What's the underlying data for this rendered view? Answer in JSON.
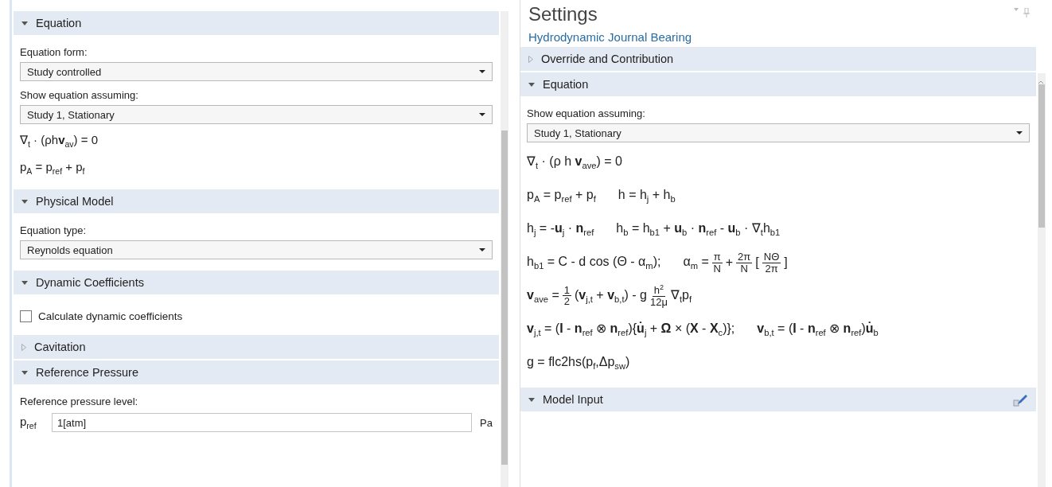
{
  "left_panel": {
    "sections": [
      {
        "title": "Equation",
        "expanded": true,
        "items": [
          {
            "kind": "label",
            "text": "Equation form:"
          },
          {
            "kind": "select",
            "value": "Study controlled"
          },
          {
            "kind": "label",
            "text": "Show equation assuming:"
          },
          {
            "kind": "select",
            "value": "Study 1, Stationary"
          },
          {
            "kind": "equation",
            "groups": [
              {
                "parts": [
                  {
                    "kind": "text",
                    "text": "∇$_{t}$ · (ρh**v**$_{av}$) = 0"
                  }
                ]
              }
            ]
          },
          {
            "kind": "equation",
            "groups": [
              {
                "parts": [
                  {
                    "kind": "text",
                    "text": "p$_{A}$ = p$_{ref}$ + p$_{f}$"
                  }
                ]
              }
            ]
          }
        ]
      },
      {
        "title": "Physical Model",
        "expanded": true,
        "items": [
          {
            "kind": "label",
            "text": "Equation type:"
          },
          {
            "kind": "select",
            "value": "Reynolds equation"
          }
        ]
      },
      {
        "title": "Dynamic Coefficients",
        "expanded": true,
        "items": [
          {
            "kind": "checkbox",
            "text": "Calculate dynamic coefficients",
            "checked": false
          }
        ]
      },
      {
        "title": "Cavitation",
        "expanded": false
      },
      {
        "title": "Reference Pressure",
        "expanded": true,
        "items": [
          {
            "kind": "label",
            "text": "Reference pressure level:"
          },
          {
            "kind": "field",
            "symbol": "p$_{ref}$",
            "value": "1[atm]",
            "unit": "Pa"
          }
        ]
      }
    ]
  },
  "right_panel": {
    "title": "Settings",
    "subtitle": "Hydrodynamic Journal Bearing",
    "sections": [
      {
        "title": "Override and Contribution",
        "expanded": false
      },
      {
        "title": "Equation",
        "expanded": true,
        "items": [
          {
            "kind": "label",
            "text": "Show equation assuming:"
          },
          {
            "kind": "select",
            "value": "Study 1, Stationary"
          },
          {
            "kind": "equation",
            "groups": [
              {
                "parts": [
                  {
                    "kind": "text",
                    "text": "∇$_{t}$ · (ρ h **v**$_{ave}$) = 0"
                  }
                ]
              }
            ]
          },
          {
            "kind": "equation",
            "groups": [
              {
                "parts": [
                  {
                    "kind": "text",
                    "text": "p$_{A}$ = p$_{ref}$ + p$_{f}$"
                  }
                ]
              },
              {
                "parts": [
                  {
                    "kind": "text",
                    "text": "h = h$_{j}$ + h$_{b}$"
                  }
                ]
              }
            ]
          },
          {
            "kind": "equation",
            "groups": [
              {
                "parts": [
                  {
                    "kind": "text",
                    "text": "h$_{j}$ = -**u**$_{j}$ · **n**$_{ref}$"
                  }
                ]
              },
              {
                "parts": [
                  {
                    "kind": "text",
                    "text": "h$_{b}$ = h$_{b1}$ + **u**$_{b}$ · **n**$_{ref}$ - **u**$_{b}$ · ∇$_{t}$h$_{b1}$"
                  }
                ]
              }
            ]
          },
          {
            "kind": "equation",
            "groups": [
              {
                "parts": [
                  {
                    "kind": "text",
                    "text": "h$_{b1}$ = C - d cos (Θ - α$_{m}$);"
                  }
                ]
              },
              {
                "parts": [
                  {
                    "kind": "text",
                    "text": "α$_{m}$ ="
                  },
                  {
                    "kind": "frac",
                    "num": "π",
                    "den": "N"
                  },
                  {
                    "kind": "text",
                    "text": "+"
                  },
                  {
                    "kind": "frac",
                    "num": "2π",
                    "den": "N"
                  },
                  {
                    "kind": "text",
                    "text": "["
                  },
                  {
                    "kind": "frac",
                    "num": "NΘ",
                    "den": "2π"
                  },
                  {
                    "kind": "text",
                    "text": "]"
                  }
                ]
              }
            ]
          },
          {
            "kind": "equation",
            "groups": [
              {
                "parts": [
                  {
                    "kind": "text",
                    "text": "**v**$_{ave}$ ="
                  },
                  {
                    "kind": "frac",
                    "num": "1",
                    "den": "2"
                  },
                  {
                    "kind": "text",
                    "text": "(**v**$_{j,t}$ + **v**$_{b,t}$) - g"
                  },
                  {
                    "kind": "frac",
                    "num": "h$^{2}$",
                    "den": "12μ"
                  },
                  {
                    "kind": "text",
                    "text": "∇$_{t}$p$_{f}$"
                  }
                ]
              }
            ]
          },
          {
            "kind": "equation",
            "groups": [
              {
                "parts": [
                  {
                    "kind": "text",
                    "text": "**v**$_{j,t}$ = (**I** - **n**$_{ref}$ ⊗ **n**$_{ref}$){**u̇**$_{j}$ + **Ω** × (**X** - **X**$_{c}$)};"
                  }
                ]
              },
              {
                "parts": [
                  {
                    "kind": "text",
                    "text": "**v**$_{b,t}$ = (**I** - **n**$_{ref}$ ⊗ **n**$_{ref}$)**u̇**$_{b}$"
                  }
                ]
              }
            ]
          },
          {
            "kind": "equation",
            "groups": [
              {
                "parts": [
                  {
                    "kind": "text",
                    "text": "g = flc2hs(p$_{f}$,Δp$_{sw}$)"
                  }
                ]
              }
            ]
          }
        ]
      },
      {
        "title": "Model Input",
        "expanded": true,
        "edit_icon": true
      }
    ]
  }
}
